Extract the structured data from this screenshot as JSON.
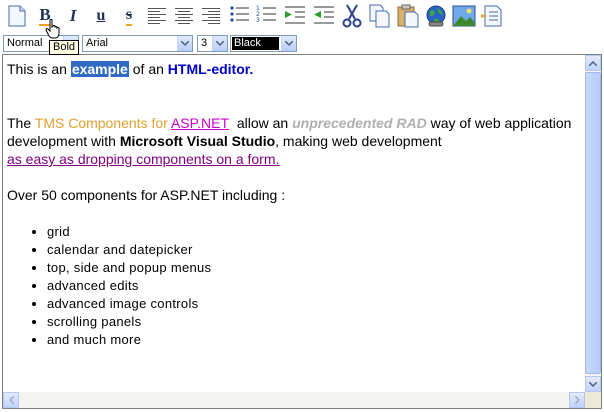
{
  "toolbar": {
    "buttons": [
      {
        "name": "new-document-icon"
      },
      {
        "name": "bold-button",
        "glyph": "B"
      },
      {
        "name": "italic-button",
        "glyph": "I"
      },
      {
        "name": "underline-button",
        "glyph": "u"
      },
      {
        "name": "strikethrough-button",
        "glyph": "s"
      },
      {
        "name": "align-left-icon"
      },
      {
        "name": "align-center-icon"
      },
      {
        "name": "align-right-icon"
      },
      {
        "name": "bullet-list-icon"
      },
      {
        "name": "numbered-list-icon"
      },
      {
        "name": "indent-icon"
      },
      {
        "name": "outdent-icon"
      },
      {
        "name": "cut-icon"
      },
      {
        "name": "copy-icon"
      },
      {
        "name": "paste-icon"
      },
      {
        "name": "insert-link-icon"
      },
      {
        "name": "insert-image-icon"
      },
      {
        "name": "insert-list-icon"
      }
    ],
    "tooltip": "Bold"
  },
  "format_bar": {
    "style_value": "Normal",
    "font_value": "Arial",
    "size_value": "3",
    "color_value": "Black"
  },
  "content": {
    "line1": {
      "pre": "This is an",
      "selected": "example",
      "mid": "of an",
      "highlight": "HTML-editor."
    },
    "para2": {
      "p1": "The",
      "tms": "TMS Components for",
      "asp_link": "ASP.NET",
      "p2": "allow an",
      "unprecedented": "unprecedented RAD",
      "p3": "way of web application development with",
      "mvs": "Microsoft Visual Studio",
      "p4": ", making web development",
      "link": "as easy as dropping components on a form."
    },
    "para3": "Over 50 components for ASP.NET including :",
    "list": [
      "grid",
      "calendar and datepicker",
      "top, side and popup menus",
      "advanced edits",
      "advanced image controls",
      "scrolling panels",
      "and much more"
    ]
  },
  "colors": {
    "selection": "#316ac5",
    "highlight_blue": "#0000cc",
    "orange_text": "#e0a030",
    "link_pink": "#cc00cc",
    "link_purple": "#800080"
  }
}
